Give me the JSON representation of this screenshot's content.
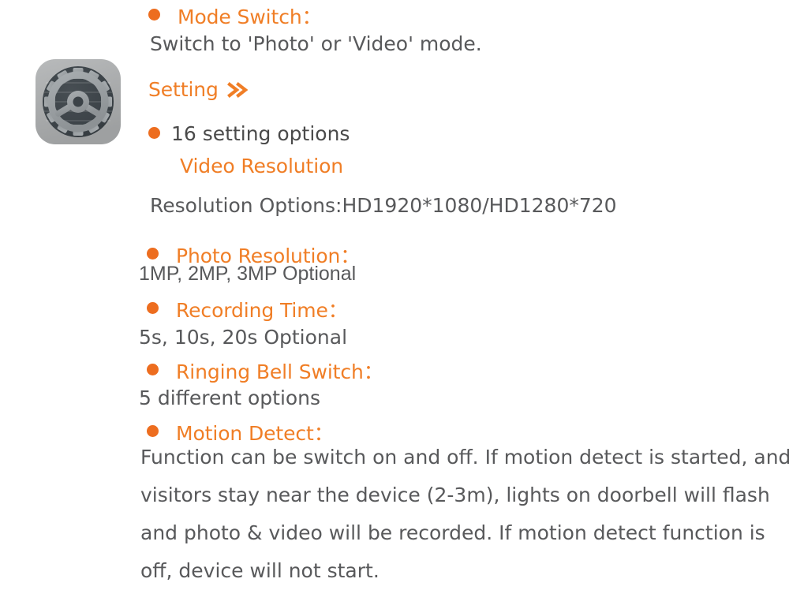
{
  "icon": {
    "name": "settings-gear-icon",
    "bg_color_outer": "#A9ABAC",
    "bg_color_inner": "#3B4247",
    "gear_color": "#9CA1A4"
  },
  "colors": {
    "accent_orange": "#F07E26",
    "bullet_orange": "#ED6D1F",
    "body_gray": "#58595B",
    "heading_gray": "#4A4A4A",
    "background": "#FFFFFF"
  },
  "sections": {
    "mode_switch": {
      "heading": "Mode Switch：",
      "description": "Switch to 'Photo' or 'Video' mode."
    },
    "setting": {
      "title": "Setting",
      "chevron": "»",
      "options_count_label": "16 setting options",
      "video_resolution": {
        "label": "Video Resolution",
        "description": "Resolution Options:HD1920*1080/HD1280*720"
      },
      "photo_resolution": {
        "heading": "Photo Resolution：",
        "description": "1MP, 2MP, 3MP Optional"
      },
      "recording_time": {
        "heading": "Recording Time：",
        "description": "5s, 10s, 20s Optional"
      },
      "ringing_bell_switch": {
        "heading": "Ringing Bell Switch：",
        "description": "5 different options"
      },
      "motion_detect": {
        "heading": "Motion Detect：",
        "description": "Function can be switch on and off. If motion detect is started, and visitors stay near the device (2-3m), lights on doorbell will flash and photo & video will be recorded.   If motion detect function is off, device will not start."
      }
    }
  }
}
